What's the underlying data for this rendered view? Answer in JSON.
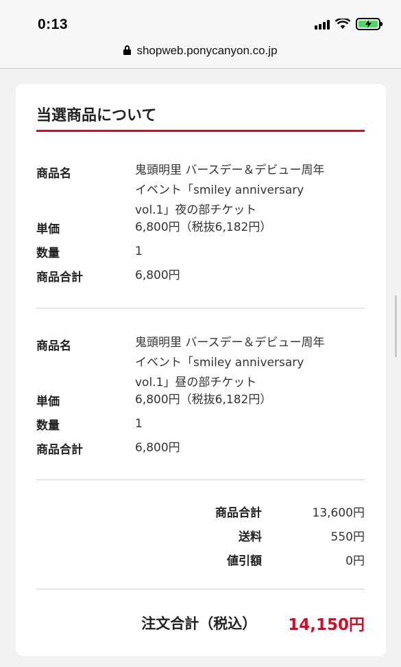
{
  "status_bar": {
    "time": "0:13"
  },
  "browser": {
    "url": "shopweb.ponycanyon.co.jp"
  },
  "section": {
    "title": "当選商品について"
  },
  "labels": {
    "product_name": "商品名",
    "unit_price": "単価",
    "quantity": "数量",
    "product_total": "商品合計"
  },
  "items": [
    {
      "name_lines": [
        "鬼頭明里 バースデー＆デビュー周年",
        "イベント「smiley anniversary",
        "vol.1」夜の部チケット"
      ],
      "unit_price": "6,800円（税抜6,182円）",
      "quantity": "1",
      "total": "6,800円"
    },
    {
      "name_lines": [
        "鬼頭明里 バースデー＆デビュー周年",
        "イベント「smiley anniversary",
        "vol.1」昼の部チケット"
      ],
      "unit_price": "6,800円（税抜6,182円）",
      "quantity": "1",
      "total": "6,800円"
    }
  ],
  "summary": {
    "subtotal_label": "商品合計",
    "subtotal_value": "13,600円",
    "shipping_label": "送料",
    "shipping_value": "550円",
    "discount_label": "値引額",
    "discount_value": "0円",
    "grand_total_label": "注文合計（税込）",
    "grand_total_value": "14,150円"
  },
  "colors": {
    "accent": "#d60b27",
    "battery": "#4cd964"
  },
  "icons": [
    "signal-icon",
    "wifi-icon",
    "battery-charging-icon",
    "lock-icon"
  ]
}
